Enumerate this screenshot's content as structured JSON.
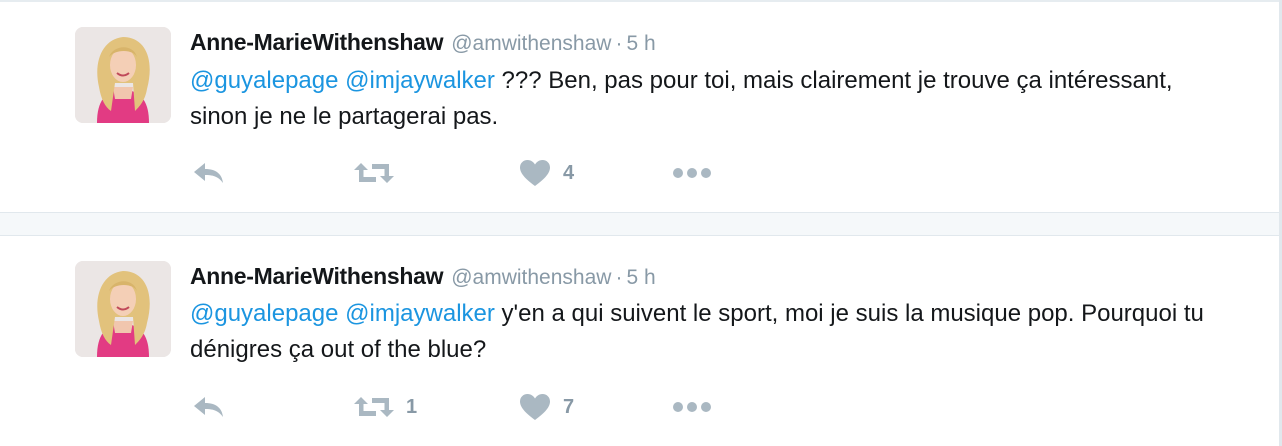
{
  "tweets": [
    {
      "author_name": "Anne-MarieWithenshaw",
      "handle": "@amwithenshaw",
      "separator": "·",
      "time": "5 h",
      "mention1": "@guyalepage",
      "mention2": "@imjaywalker",
      "body": " ??? Ben, pas pour toi, mais clairement je trouve ça intéressant, sinon je ne le partagerai pas.",
      "retweet_count": "",
      "like_count": "4"
    },
    {
      "author_name": "Anne-MarieWithenshaw",
      "handle": "@amwithenshaw",
      "separator": "·",
      "time": "5 h",
      "mention1": "@guyalepage",
      "mention2": "@imjaywalker",
      "body": " y'en a qui suivent le sport, moi je suis la musique pop. Pourquoi tu dénigres ça out of the blue?",
      "retweet_count": "1",
      "like_count": "7"
    }
  ],
  "colors": {
    "mention": "#1b95e0",
    "muted": "#8899a6",
    "text": "#14171a",
    "icon": "#aab8c2"
  },
  "icons": {
    "reply": "reply-icon",
    "retweet": "retweet-icon",
    "like": "heart-icon",
    "more": "more-icon"
  }
}
